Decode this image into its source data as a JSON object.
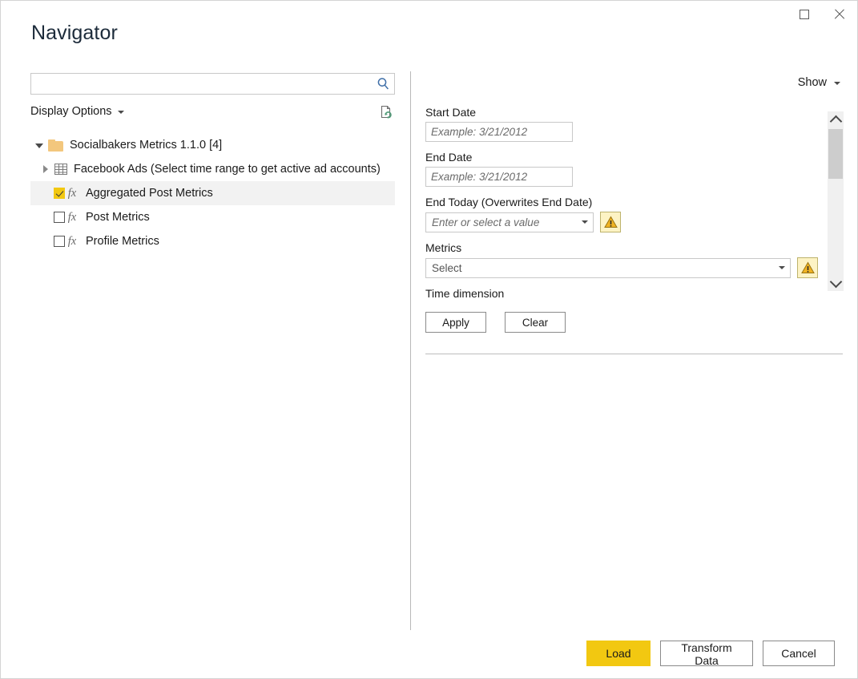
{
  "window": {
    "title": "Navigator",
    "controls": [
      {
        "name": "maximize",
        "label": "Maximize"
      },
      {
        "name": "close",
        "label": "Close"
      }
    ]
  },
  "search": {
    "value": "",
    "placeholder": "",
    "icon": "search-icon"
  },
  "left_pane": {
    "display_options_label": "Display Options",
    "refresh_icon": "refresh-preview-icon",
    "tree": [
      {
        "label": "Socialbakers Metrics 1.1.0 [4]",
        "icon": "folder-icon",
        "level": 0,
        "expander": "expanded",
        "checkbox": "none",
        "selected": false
      },
      {
        "label": "Facebook Ads (Select time range to get active ad accounts)",
        "icon": "table-icon",
        "level": 1,
        "expander": "collapsed",
        "checkbox": "none",
        "selected": false
      },
      {
        "label": "Aggregated Post Metrics",
        "icon": "fx-icon",
        "level": 1,
        "expander": "none",
        "checkbox": "checked",
        "selected": true
      },
      {
        "label": "Post Metrics",
        "icon": "fx-icon",
        "level": 1,
        "expander": "none",
        "checkbox": "unchecked",
        "selected": false
      },
      {
        "label": "Profile Metrics",
        "icon": "fx-icon",
        "level": 1,
        "expander": "none",
        "checkbox": "unchecked",
        "selected": false
      }
    ]
  },
  "right_pane": {
    "show_label": "Show",
    "fields": {
      "start_date": {
        "label": "Start Date",
        "value": "",
        "placeholder": "Example: 3/21/2012"
      },
      "end_date": {
        "label": "End Date",
        "value": "",
        "placeholder": "Example: 3/21/2012"
      },
      "end_today": {
        "label": "End Today (Overwrites End Date)",
        "value": "Enter or select a value",
        "warning": "warning-icon"
      },
      "metrics": {
        "label": "Metrics",
        "value": "Select",
        "warning": "warning-icon"
      },
      "time_dimension": {
        "label": "Time dimension"
      }
    },
    "apply_label": "Apply",
    "clear_label": "Clear"
  },
  "footer": {
    "load_label": "Load",
    "transform_label": "Transform Data",
    "cancel_label": "Cancel"
  },
  "colors": {
    "accent": "#f2c811",
    "title": "#1c2b3a",
    "border": "#c8c8c8",
    "warning_bg": "#fdf3c4"
  }
}
